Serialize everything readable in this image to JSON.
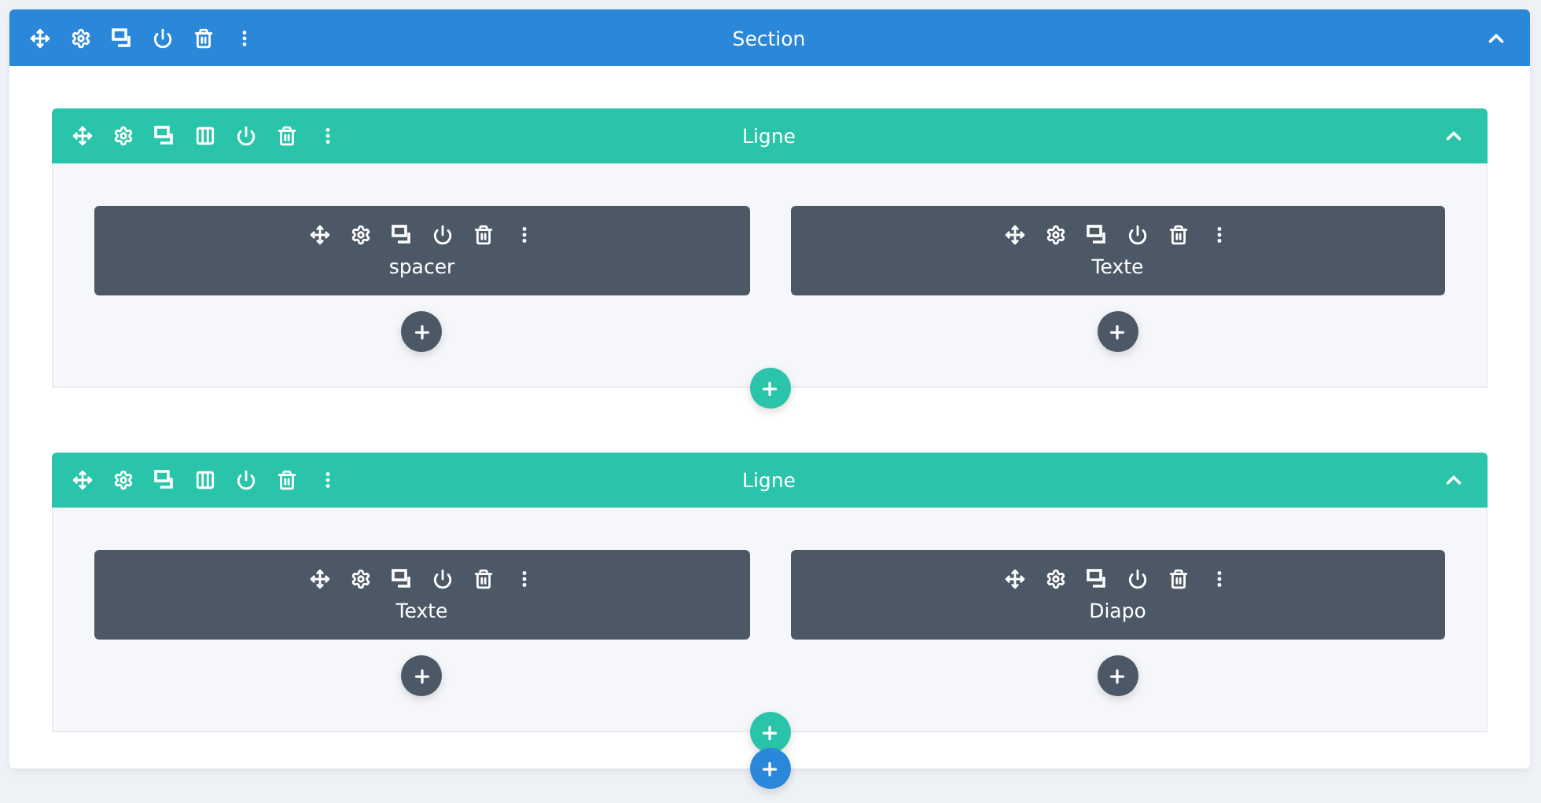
{
  "section": {
    "title": "Section",
    "rows": [
      {
        "title": "Ligne",
        "modules": [
          {
            "title": "spacer"
          },
          {
            "title": "Texte"
          }
        ]
      },
      {
        "title": "Ligne",
        "modules": [
          {
            "title": "Texte"
          },
          {
            "title": "Diapo"
          }
        ]
      }
    ]
  }
}
